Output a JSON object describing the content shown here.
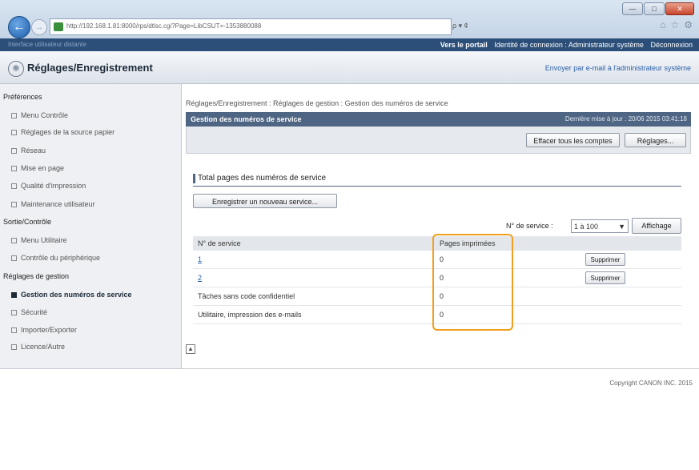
{
  "browser": {
    "url": "http://192.168.1.81:8000/rps/dtlsc.cgi?Page=LibCSUT=-1353880088",
    "search_hint": "ρ ▾ ¢",
    "window_controls": [
      "—",
      "□",
      "✕"
    ],
    "nav_back_icon": "arrow-left-icon",
    "favorite_icons": [
      "⌂",
      "☆",
      "⚙"
    ]
  },
  "topbar": {
    "left_text": "Interface utilisateur distante",
    "portal": "Vers le portail",
    "login_identity": "Identité de connexion : Administrateur système",
    "logout": "Déconnexion"
  },
  "header": {
    "title": "Réglages/Enregistrement",
    "email_link": "Envoyer par e-mail à l'administrateur système"
  },
  "sidebar": {
    "sections": [
      {
        "title": "Préférences",
        "items": [
          "Menu Contrôle",
          "Réglages de la source papier",
          "Réseau",
          "Mise en page",
          "Qualité d'impression",
          "Maintenance utilisateur"
        ]
      },
      {
        "title": "Sortie/Contrôle",
        "items": [
          "Menu Utilitaire",
          "Contrôle du périphérique"
        ]
      },
      {
        "title": "Réglages de gestion",
        "items": [
          "Gestion des numéros de service",
          "Sécurité",
          "Importer/Exporter",
          "Licence/Autre"
        ]
      }
    ],
    "active_item": "Gestion des numéros de service"
  },
  "main": {
    "breadcrumb": "Réglages/Enregistrement : Réglages de gestion : Gestion des numéros de service",
    "panel_title": "Gestion des numéros de service",
    "last_update": "Dernière mise à jour : 20/06 2015 03:41:18",
    "btn_clear": "Effacer tous les comptes",
    "btn_settings": "Réglages...",
    "section_title": "Total pages des numéros de service",
    "btn_register": "Enregistrer un nouveau service...",
    "filter_label": "N° de service :",
    "filter_value": "1 à 100",
    "btn_display": "Affichage",
    "table": {
      "headers": [
        "N° de service",
        "Pages imprimées",
        ""
      ],
      "rows": [
        {
          "name": "1",
          "pages": "0",
          "action": "Supprimer"
        },
        {
          "name": "2",
          "pages": "0",
          "action": "Supprimer"
        },
        {
          "name": "Tâches sans code confidentiel",
          "pages": "0",
          "action": ""
        },
        {
          "name": "Utilitaire, impression des e-mails",
          "pages": "0",
          "action": ""
        }
      ]
    }
  },
  "footer": {
    "copyright": "Copyright CANON INC. 2015"
  }
}
